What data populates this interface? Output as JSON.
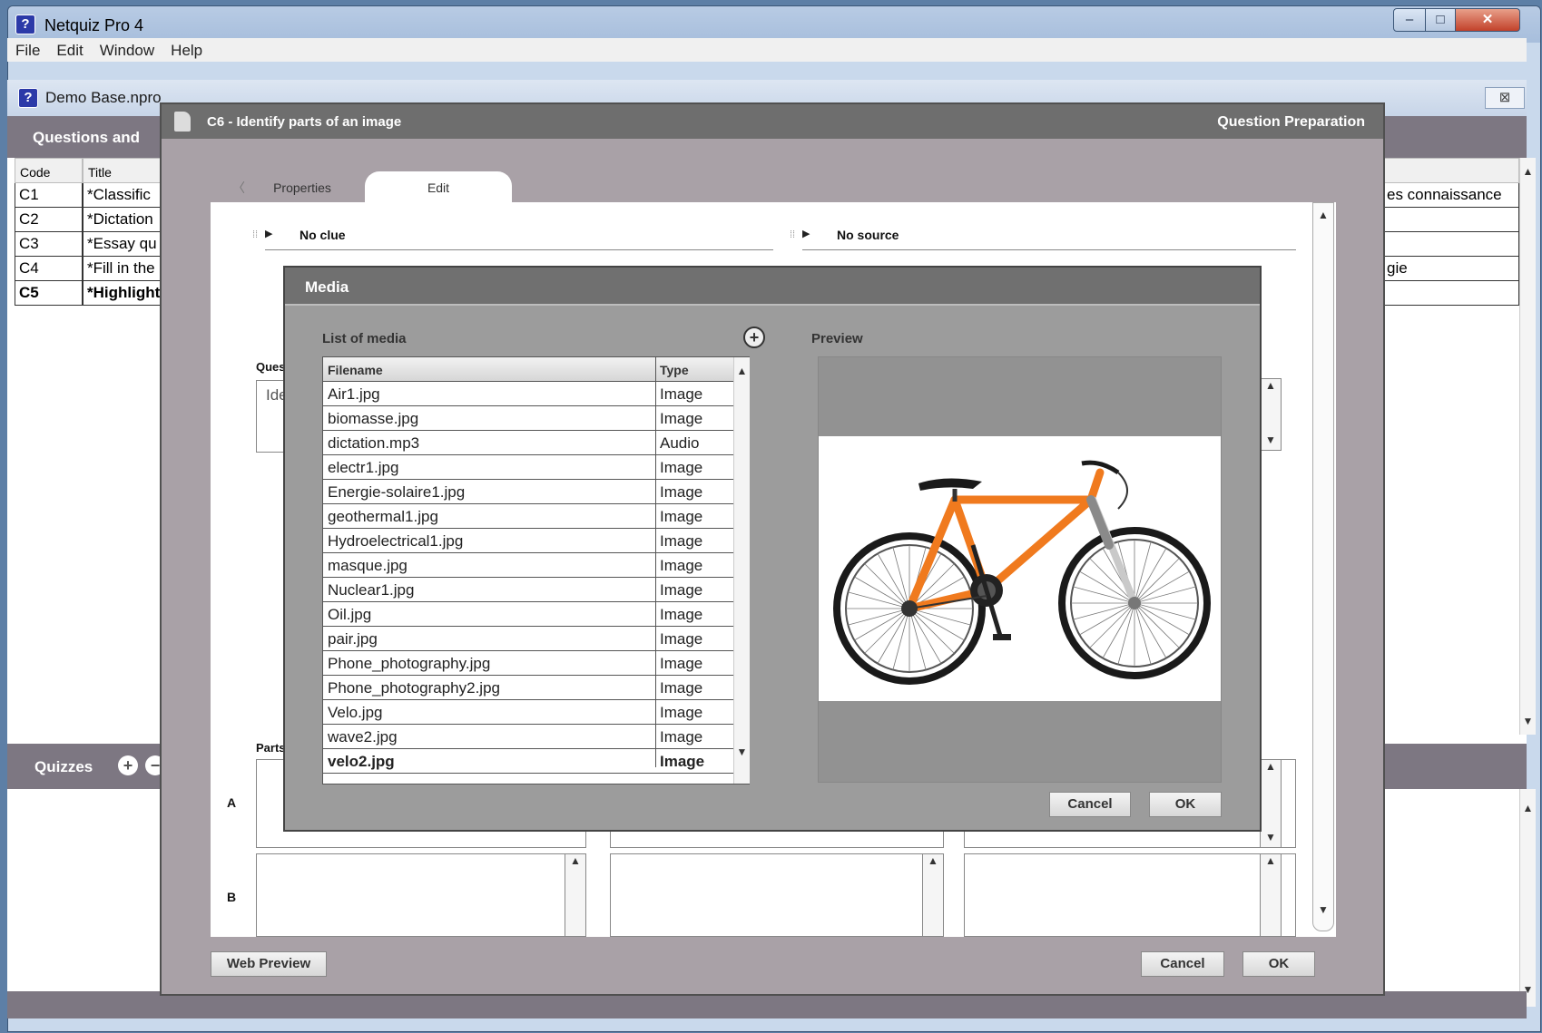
{
  "window": {
    "title": "Netquiz Pro 4",
    "app_icon": "?",
    "minimize": "–",
    "maximize": "□",
    "close": "✕"
  },
  "menu": [
    "File",
    "Edit",
    "Window",
    "Help"
  ],
  "document": {
    "title": "Demo Base.npro",
    "icon": "?",
    "close": "⊠"
  },
  "questions_panel": {
    "header": "Questions and",
    "col_code": "Code",
    "col_title": "Title",
    "rows": [
      {
        "code": "C1",
        "title": "*Classific",
        "extra": "es connaissance"
      },
      {
        "code": "C2",
        "title": "*Dictation",
        "extra": ""
      },
      {
        "code": "C3",
        "title": "*Essay qu",
        "extra": ""
      },
      {
        "code": "C4",
        "title": "*Fill in the",
        "extra": "gie"
      },
      {
        "code": "C5",
        "title": "*Highlight",
        "extra": ""
      }
    ]
  },
  "quizzes": {
    "label": "Quizzes",
    "add_icon": "+",
    "remove_icon": "−"
  },
  "question_dialog": {
    "title": "C6 - Identify parts of an image",
    "mode": "Question Preparation",
    "tabs": [
      "Properties",
      "Edit"
    ],
    "active_tab": "Edit",
    "clue": "No clue",
    "source": "No source",
    "question_label": "Ques",
    "question_text": "Ide",
    "parts_label": "Parts",
    "row_a": "A",
    "row_b": "B",
    "web_preview": "Web Preview",
    "cancel": "Cancel",
    "ok": "OK"
  },
  "media_dialog": {
    "title": "Media",
    "list_label": "List of media",
    "add_icon": "+",
    "preview_label": "Preview",
    "col_filename": "Filename",
    "col_type": "Type",
    "items": [
      {
        "filename": "Air1.jpg",
        "type": "Image"
      },
      {
        "filename": "biomasse.jpg",
        "type": "Image"
      },
      {
        "filename": "dictation.mp3",
        "type": "Audio"
      },
      {
        "filename": "electr1.jpg",
        "type": "Image"
      },
      {
        "filename": "Energie-solaire1.jpg",
        "type": "Image"
      },
      {
        "filename": "geothermal1.jpg",
        "type": "Image"
      },
      {
        "filename": "Hydroelectrical1.jpg",
        "type": "Image"
      },
      {
        "filename": "masque.jpg",
        "type": "Image"
      },
      {
        "filename": "Nuclear1.jpg",
        "type": "Image"
      },
      {
        "filename": "Oil.jpg",
        "type": "Image"
      },
      {
        "filename": "pair.jpg",
        "type": "Image"
      },
      {
        "filename": "Phone_photography.jpg",
        "type": "Image"
      },
      {
        "filename": "Phone_photography2.jpg",
        "type": "Image"
      },
      {
        "filename": "Velo.jpg",
        "type": "Image"
      },
      {
        "filename": "wave2.jpg",
        "type": "Image"
      },
      {
        "filename": "velo2.jpg",
        "type": "Image"
      }
    ],
    "selected_item": "velo2.jpg",
    "cancel": "Cancel",
    "ok": "OK"
  },
  "colors": {
    "panel_header": "#7d7782",
    "dialog_bg": "#a9a1a7",
    "media_bg": "#9c9c9c",
    "bike_frame": "#f07a1e"
  }
}
